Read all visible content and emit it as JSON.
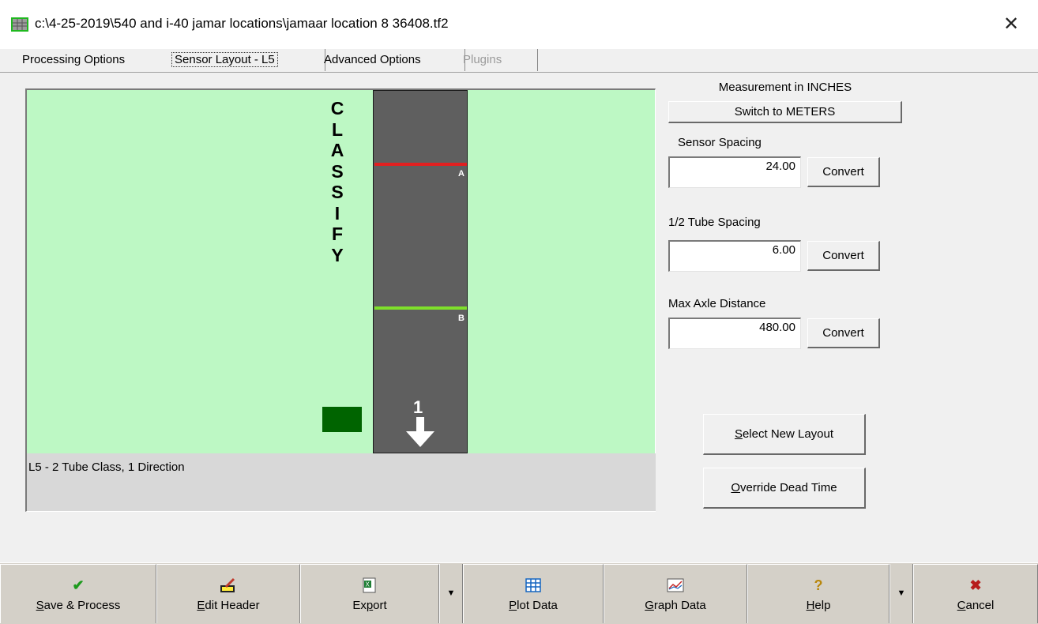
{
  "window": {
    "title": "c:\\4-25-2019\\540 and i-40 jamar locations\\jamaar location 8 36408.tf2",
    "app_icon": "grid-app-icon",
    "close_icon": "close-icon"
  },
  "tabs": [
    {
      "label": "Processing Options",
      "state": "normal"
    },
    {
      "label": "Sensor Layout - L5",
      "state": "selected"
    },
    {
      "label": "Advanced Options",
      "state": "normal"
    },
    {
      "label": "Plugins",
      "state": "disabled"
    }
  ],
  "layout_view": {
    "classify_letters": [
      "C",
      "L",
      "A",
      "S",
      "S",
      "I",
      "F",
      "Y"
    ],
    "sensor_a": {
      "label": "A",
      "color": "#e12020"
    },
    "sensor_b": {
      "label": "B",
      "color": "#7ee02a"
    },
    "lane_number": "1",
    "background_color": "#bdf8c4",
    "road_color": "#5f5f5f"
  },
  "description": "L5 - 2 Tube Class, 1 Direction",
  "settings": {
    "measurement_label": "Measurement in INCHES",
    "switch_units_label": "Switch to METERS",
    "sensor_spacing": {
      "label": "Sensor Spacing",
      "value": "24.00",
      "convert_label": "Convert"
    },
    "half_tube_spacing": {
      "label": "1/2 Tube Spacing",
      "value": "6.00",
      "convert_label": "Convert"
    },
    "max_axle_distance": {
      "label": "Max Axle Distance",
      "value": "480.00",
      "convert_label": "Convert"
    },
    "select_new_layout": {
      "hotkey": "S",
      "rest": "elect New Layout"
    },
    "override_dead_time": {
      "hotkey": "O",
      "rest": "verride Dead Time"
    }
  },
  "toolbar": {
    "save_process": {
      "hotkey": "S",
      "rest": "ave & Process",
      "icon": "checkmark-icon"
    },
    "edit_header": {
      "hotkey": "E",
      "rest": "dit Header",
      "icon": "edit-icon"
    },
    "export": {
      "pre": "Ex",
      "hotkey": "p",
      "rest": "ort",
      "icon": "excel-icon"
    },
    "plot_data": {
      "hotkey": "P",
      "rest": "lot Data",
      "icon": "grid-icon"
    },
    "graph_data": {
      "hotkey": "G",
      "rest": "raph Data",
      "icon": "graph-icon"
    },
    "help": {
      "hotkey": "H",
      "rest": "elp",
      "icon": "help-icon"
    },
    "cancel": {
      "hotkey": "C",
      "rest": "ancel",
      "icon": "x-icon"
    }
  }
}
